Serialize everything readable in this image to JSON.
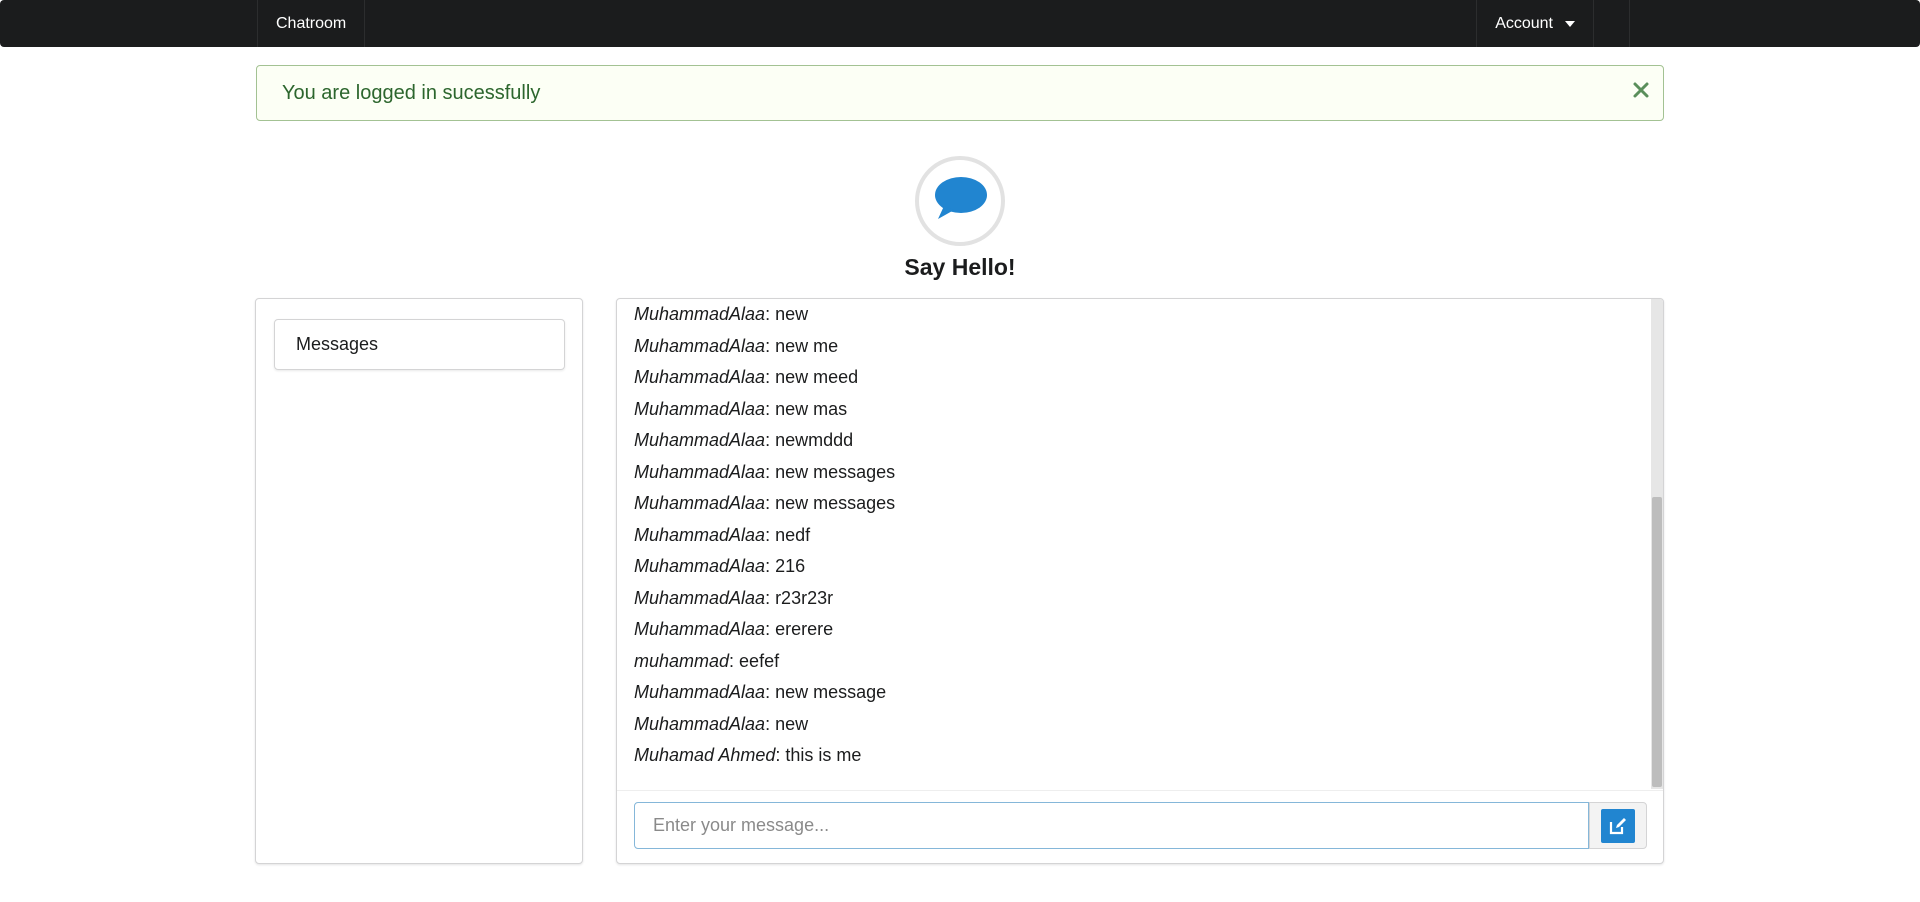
{
  "navbar": {
    "brand": "Chatroom",
    "account_label": "Account"
  },
  "alert": {
    "message": "You are logged in sucessfully"
  },
  "header": {
    "title": "Say Hello!"
  },
  "sidebar": {
    "items": [
      {
        "label": "Messages"
      }
    ]
  },
  "chat": {
    "messages": [
      {
        "author": "MuhammadAlaa",
        "text": ": new"
      },
      {
        "author": "MuhammadAlaa",
        "text": ": new me"
      },
      {
        "author": "MuhammadAlaa",
        "text": ": new meed"
      },
      {
        "author": "MuhammadAlaa",
        "text": ": new mas"
      },
      {
        "author": "MuhammadAlaa",
        "text": ": newmddd"
      },
      {
        "author": "MuhammadAlaa",
        "text": ": new messages"
      },
      {
        "author": "MuhammadAlaa",
        "text": ": new messages"
      },
      {
        "author": "MuhammadAlaa",
        "text": ": nedf"
      },
      {
        "author": "MuhammadAlaa",
        "text": ": 216"
      },
      {
        "author": "MuhammadAlaa",
        "text": ": r23r23r"
      },
      {
        "author": "MuhammadAlaa",
        "text": ": ererere"
      },
      {
        "author": "muhammad",
        "text": ": eefef"
      },
      {
        "author": "MuhammadAlaa",
        "text": ": new message"
      },
      {
        "author": "MuhammadAlaa",
        "text": ": new"
      },
      {
        "author": "Muhamad Ahmed",
        "text": ": this is me"
      }
    ],
    "input": {
      "value": "",
      "placeholder": "Enter your message..."
    }
  },
  "icons": {
    "header": "speech-bubble-icon",
    "send": "edit-icon",
    "close": "close-icon",
    "dropdown": "caret-down-icon"
  },
  "colors": {
    "navbar": "#1b1c1d",
    "alert_bg": "#fcfff5",
    "alert_text": "#2c662d",
    "alert_border": "#a3c293",
    "accent": "#2185d0"
  }
}
